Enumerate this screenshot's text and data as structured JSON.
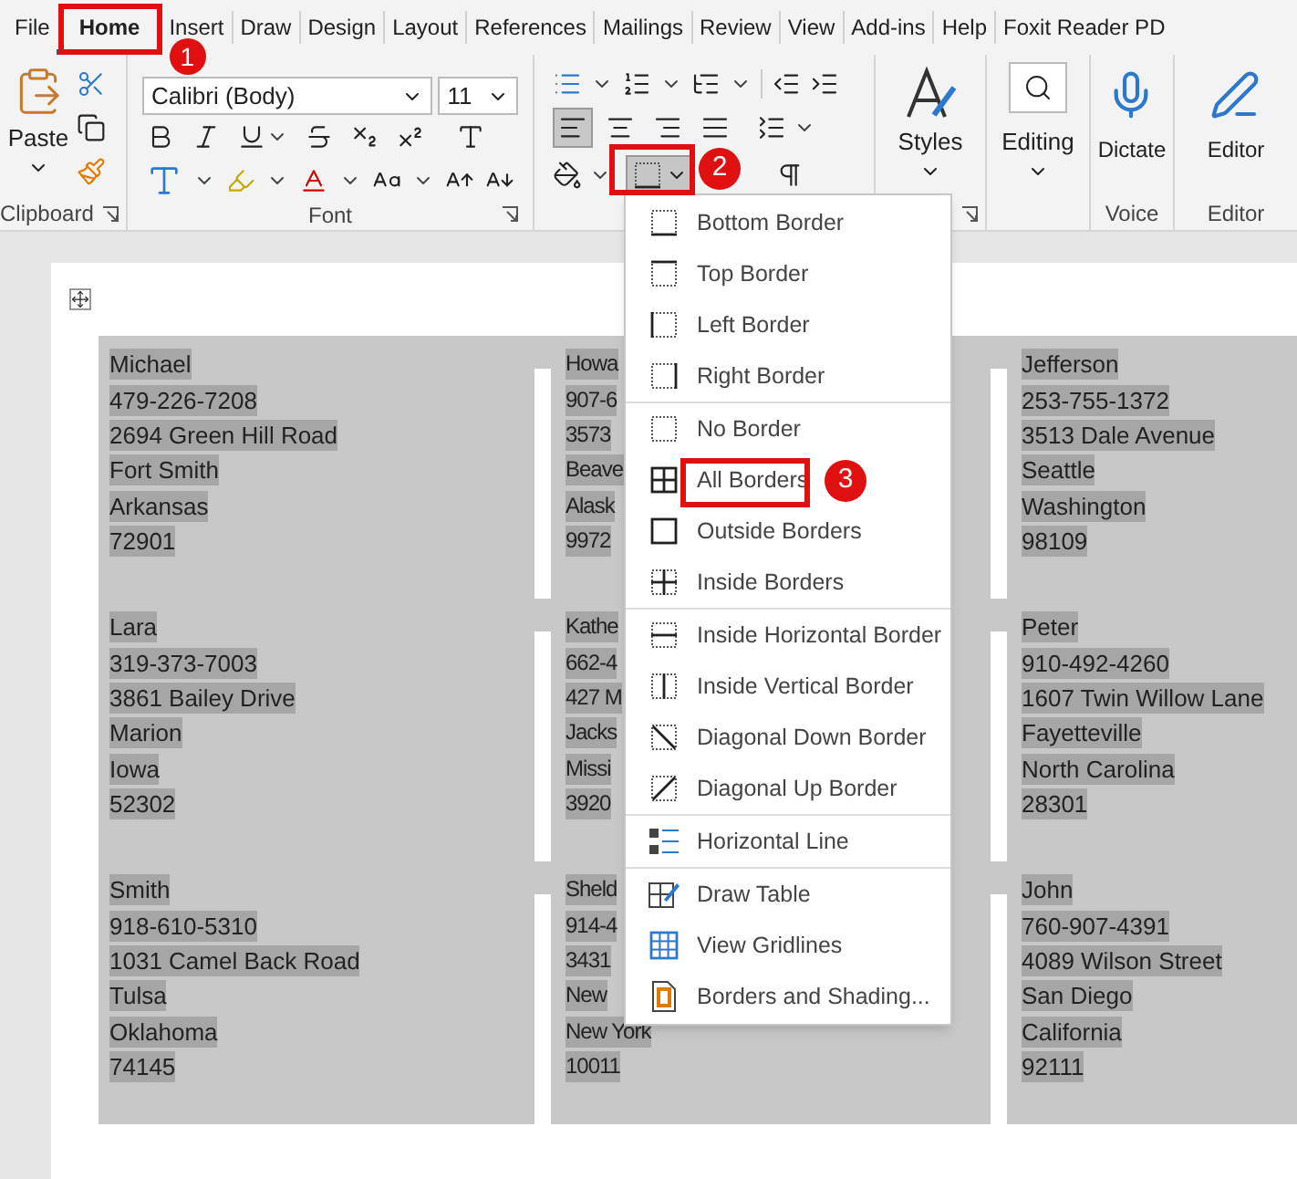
{
  "tabs": [
    {
      "label": "File",
      "selected": false
    },
    {
      "label": "Home",
      "selected": true
    },
    {
      "label": "Insert",
      "selected": false
    },
    {
      "label": "Draw",
      "selected": false
    },
    {
      "label": "Design",
      "selected": false
    },
    {
      "label": "Layout",
      "selected": false
    },
    {
      "label": "References",
      "selected": false
    },
    {
      "label": "Mailings",
      "selected": false
    },
    {
      "label": "Review",
      "selected": false
    },
    {
      "label": "View",
      "selected": false
    },
    {
      "label": "Add-ins",
      "selected": false
    },
    {
      "label": "Help",
      "selected": false
    },
    {
      "label": "Foxit Reader PD",
      "selected": false
    }
  ],
  "clipboard": {
    "paste": "Paste",
    "label": "Clipboard"
  },
  "font": {
    "name": "Calibri (Body)",
    "size": "11",
    "label": "Font"
  },
  "paragraph": {
    "align": [
      {
        "selected": true
      },
      {
        "selected": false
      },
      {
        "selected": false
      },
      {
        "selected": false
      }
    ],
    "borders_pressed": true
  },
  "styles": {
    "button": "Styles"
  },
  "editing": {
    "button": "Editing"
  },
  "voice": {
    "button": "Dictate",
    "label": "Voice"
  },
  "editor": {
    "button": "Editor",
    "label": "Editor"
  },
  "border_menu": {
    "sections": [
      {
        "items": [
          {
            "label": "Bottom Border"
          },
          {
            "label": "Top Border"
          },
          {
            "label": "Left Border"
          },
          {
            "label": "Right Border"
          }
        ]
      },
      {
        "items": [
          {
            "label": "No Border"
          },
          {
            "label": "All Borders"
          },
          {
            "label": "Outside Borders"
          },
          {
            "label": "Inside Borders"
          }
        ]
      },
      {
        "items": [
          {
            "label": "Inside Horizontal Border"
          },
          {
            "label": "Inside Vertical Border"
          },
          {
            "label": "Diagonal Down Border"
          },
          {
            "label": "Diagonal Up Border"
          }
        ]
      },
      {
        "items": [
          {
            "label": "Horizontal Line"
          }
        ]
      },
      {
        "items": [
          {
            "label": "Draw Table"
          },
          {
            "label": "View Gridlines"
          },
          {
            "label": "Borders and Shading..."
          }
        ]
      }
    ]
  },
  "annotations": [
    {
      "label": "1"
    },
    {
      "label": "2"
    },
    {
      "label": "3"
    }
  ],
  "document": {
    "rows": [
      {
        "cards": [
          {
            "lines": [
              "Michael",
              "479-226-7208",
              "2694 Green Hill Road",
              "Fort Smith",
              "Arkansas",
              "72901"
            ]
          },
          {
            "lines": [
              "Howa",
              "907-6",
              "3573",
              "Beave",
              "Alask",
              "9972"
            ]
          },
          {
            "lines": [
              "Jefferson",
              "253-755-1372",
              "3513 Dale Avenue",
              "Seattle",
              "Washington",
              "98109"
            ]
          }
        ]
      },
      {
        "cards": [
          {
            "lines": [
              "Lara",
              "319-373-7003",
              "3861 Bailey Drive",
              "Marion",
              "Iowa",
              "52302"
            ]
          },
          {
            "lines": [
              "Kathe",
              "662-4",
              "427 M",
              "Jacks",
              "Missi",
              "3920"
            ]
          },
          {
            "lines": [
              "Peter",
              "910-492-4260",
              "1607 Twin Willow Lane",
              "Fayetteville",
              "North Carolina",
              "28301"
            ]
          }
        ]
      },
      {
        "cards": [
          {
            "lines": [
              "Smith",
              "918-610-5310",
              "1031 Camel Back Road",
              "Tulsa",
              "Oklahoma",
              "74145"
            ]
          },
          {
            "lines": [
              "Sheld",
              "914-4",
              "3431",
              "New",
              "New York",
              "10011"
            ]
          },
          {
            "lines": [
              "John",
              "760-907-4391",
              "4089 Wilson Street",
              "San Diego",
              "California",
              "92111"
            ]
          }
        ]
      }
    ]
  }
}
